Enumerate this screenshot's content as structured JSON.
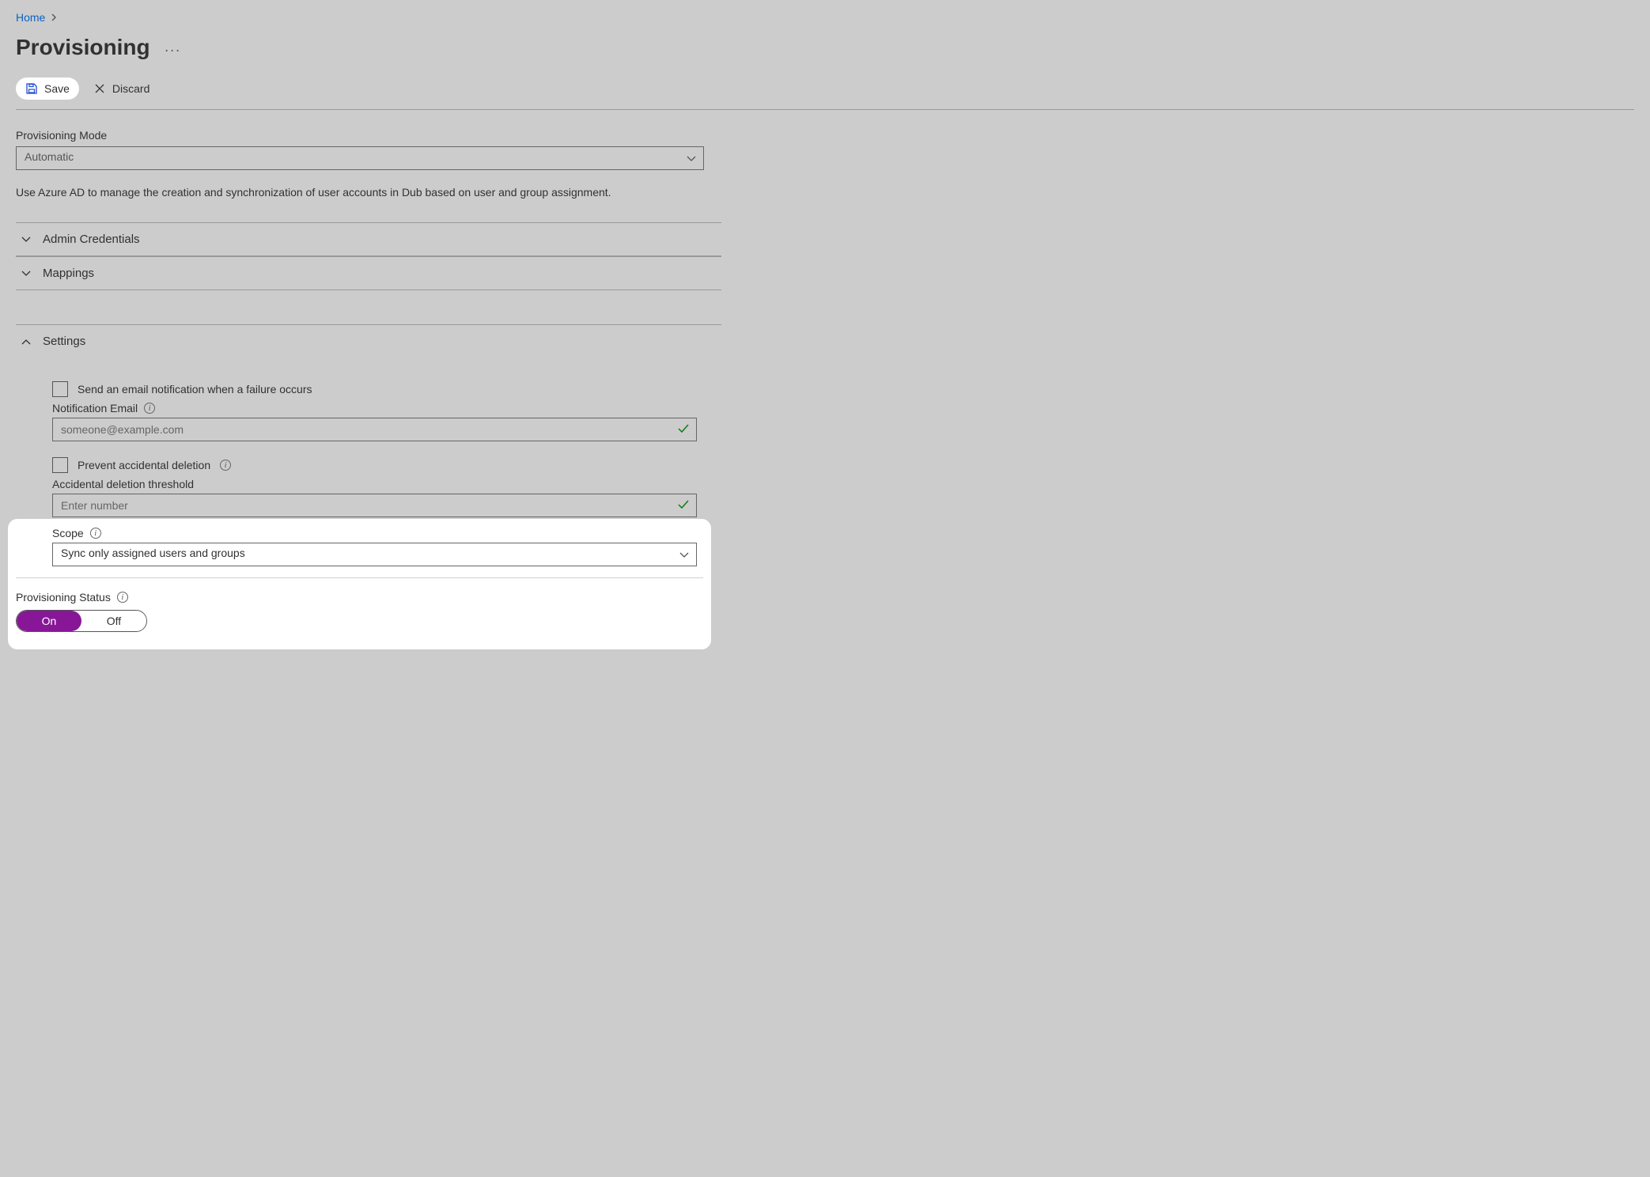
{
  "breadcrumb": {
    "home": "Home"
  },
  "page_title": "Provisioning",
  "toolbar": {
    "save": "Save",
    "discard": "Discard"
  },
  "mode": {
    "label": "Provisioning Mode",
    "value": "Automatic",
    "description": "Use Azure AD to manage the creation and synchronization of user accounts in Dub based on user and group assignment."
  },
  "sections": {
    "admin_credentials": "Admin Credentials",
    "mappings": "Mappings",
    "settings": "Settings"
  },
  "settings": {
    "send_email_label": "Send an email notification when a failure occurs",
    "notification_email_label": "Notification Email",
    "notification_email_placeholder": "someone@example.com",
    "prevent_deletion_label": "Prevent accidental deletion",
    "threshold_label": "Accidental deletion threshold",
    "threshold_placeholder": "Enter number",
    "scope_label": "Scope",
    "scope_value": "Sync only assigned users and groups"
  },
  "status": {
    "label": "Provisioning Status",
    "on": "On",
    "off": "Off"
  }
}
